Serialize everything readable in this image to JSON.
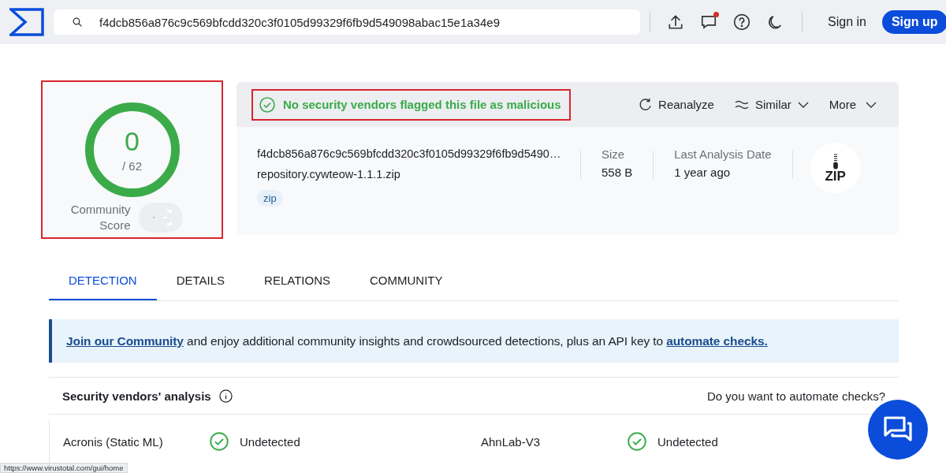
{
  "header": {
    "search": {
      "value": "f4dcb856a876c9c569bfcdd320c3f0105d99329f6fb9d549098abac15e1a34e9"
    },
    "notification_dot": true,
    "sign_in": "Sign in",
    "sign_up": "Sign up"
  },
  "score": {
    "detections": "0",
    "total": "/ 62",
    "label": "Community Score",
    "annotated": true
  },
  "verdict": {
    "text": "No security vendors flagged this file as malicious",
    "annotated": true
  },
  "actions": [
    {
      "label": "Reanalyze",
      "kind": "reanalyze"
    },
    {
      "label": "Similar",
      "kind": "similar"
    },
    {
      "label": "More",
      "kind": "more"
    }
  ],
  "file": {
    "hash": "f4dcb856a876c9c569bfcdd320c3f0105d99329f6fb9d5490…",
    "name": "repository.cywteow-1.1.1.zip",
    "tags": [
      "zip"
    ],
    "stats": [
      {
        "label": "Size",
        "value": "558 B"
      },
      {
        "label": "Last Analysis Date",
        "value": "1 year ago"
      }
    ],
    "type_badge": "ZIP"
  },
  "tabs": [
    {
      "label": "DETECTION",
      "selected": true
    },
    {
      "label": "DETAILS",
      "selected": false
    },
    {
      "label": "RELATIONS",
      "selected": false
    },
    {
      "label": "COMMUNITY",
      "selected": false
    }
  ],
  "banner": {
    "parts": [
      {
        "kind": "link",
        "text": "Join our Community"
      },
      {
        "kind": "text",
        "text": " and enjoy additional community insights and crowdsourced detections, plus an API key to "
      },
      {
        "kind": "link",
        "text": "automate checks."
      }
    ]
  },
  "vendors": {
    "title": "Security vendors' analysis",
    "prompt": "Do you want to automate checks?",
    "rows": [
      [
        {
          "name": "Acronis (Static ML)",
          "result": "Undetected",
          "detected": false
        },
        {
          "name": "AhnLab-V3",
          "result": "Undetected",
          "detected": false
        }
      ]
    ]
  },
  "status_url": "https://www.virustotal.com/gui/home"
}
